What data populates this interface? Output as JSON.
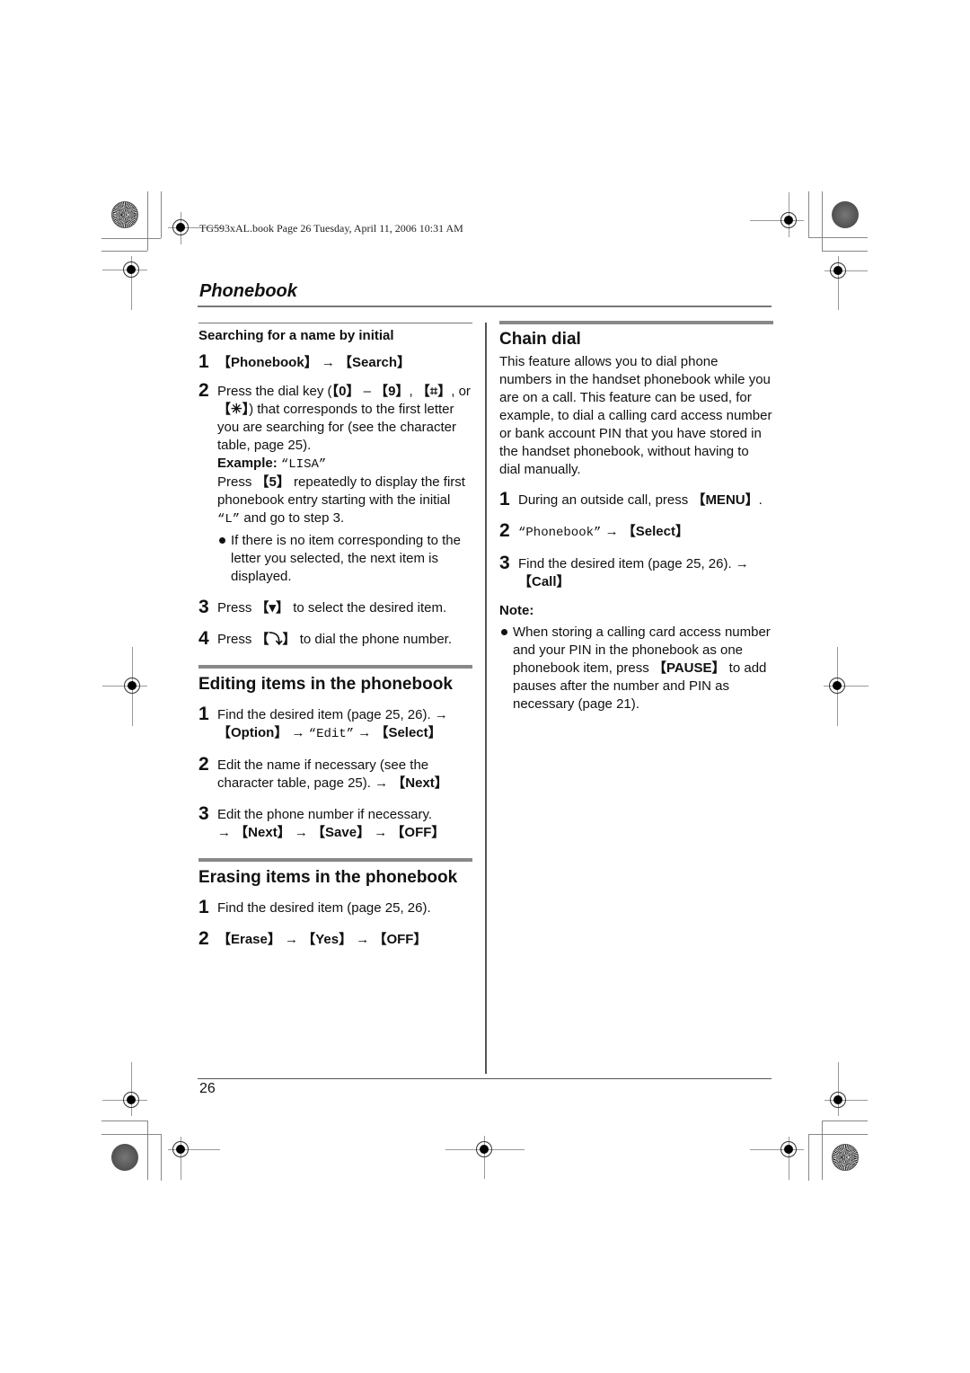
{
  "print_header": "TG593xAL.book  Page 26  Tuesday, April 11, 2006  10:31 AM",
  "section_title": "Phonebook",
  "left": {
    "search_initial": {
      "heading": "Searching for a name by initial",
      "steps": [
        {
          "num": "1",
          "key1": "【Phonebook】",
          "arrow": " → ",
          "key2": "【Search】"
        },
        {
          "num": "2",
          "text_a": "Press the dial key (",
          "k0": "【0】",
          "dash": " – ",
          "k9": "【9】",
          "comma": ", ",
          "khash": "【⌗】",
          "or": ", or ",
          "kstar": "【✳】",
          "text_b": ") that corresponds to the first letter you are searching for (see the character table, page 25).",
          "example_label": "Example: ",
          "example_value": "“LISA”",
          "press_a": "Press ",
          "k5": "【5】",
          "press_b": " repeatedly to display the first phonebook entry starting with the initial ",
          "initial": "“L”",
          "press_c": " and go to step 3.",
          "bullet": "If there is no item corresponding to the letter you selected, the next item is displayed."
        },
        {
          "num": "3",
          "text_a": "Press ",
          "key": "【▾】",
          "text_b": " to select the desired item."
        },
        {
          "num": "4",
          "text_a": "Press ",
          "key": "【⤵】",
          "text_b": " to dial the phone number."
        }
      ]
    },
    "editing": {
      "heading": "Editing items in the phonebook",
      "steps": [
        {
          "num": "1",
          "text": "Find the desired item (page 25, 26). → ",
          "k1": "【Option】",
          "a1": " → ",
          "menu": "“Edit”",
          "a2": " → ",
          "k2": "【Select】"
        },
        {
          "num": "2",
          "text": "Edit the name if necessary (see the character table, page 25). → ",
          "k1": "【Next】"
        },
        {
          "num": "3",
          "text": "Edit the phone number if necessary.",
          "a0": "→ ",
          "k1": "【Next】",
          "a1": " → ",
          "k2": "【Save】",
          "a2": " → ",
          "k3": "【OFF】"
        }
      ]
    },
    "erasing": {
      "heading": "Erasing items in the phonebook",
      "steps": [
        {
          "num": "1",
          "text": "Find the desired item (page 25, 26)."
        },
        {
          "num": "2",
          "k1": "【Erase】",
          "a1": " → ",
          "k2": "【Yes】",
          "a2": " → ",
          "k3": "【OFF】"
        }
      ]
    }
  },
  "right": {
    "chain_dial": {
      "heading": "Chain dial",
      "intro": "This feature allows you to dial phone numbers in the handset phonebook while you are on a call. This feature can be used, for example, to dial a calling card access number or bank account PIN that you have stored in the handset phonebook, without having to dial manually.",
      "steps": [
        {
          "num": "1",
          "text": "During an outside call, press ",
          "k1": "【MENU】",
          "end": "."
        },
        {
          "num": "2",
          "menu": "“Phonebook”",
          "a1": " → ",
          "k1": "【Select】"
        },
        {
          "num": "3",
          "text": "Find the desired item (page 25, 26). → ",
          "k1": "【Call】"
        }
      ],
      "note_label": "Note:",
      "note_a": "When storing a calling card access number and your PIN in the phonebook as one phonebook item, press ",
      "note_key": "【PAUSE】",
      "note_b": " to add pauses after the number and PIN as necessary (page 21)."
    }
  },
  "page_number": "26"
}
